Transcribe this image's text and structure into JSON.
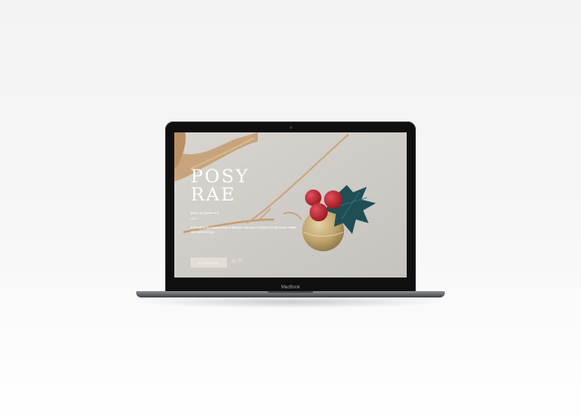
{
  "device": {
    "label": "MacBook"
  },
  "site": {
    "brand_line1": "POSY",
    "brand_line2": "RAE",
    "pronunciation": "posy rae [pəʊzɪ reɪ]",
    "tag": "noun",
    "description": "A thoughtfully curated floral & lifestyle collection of pieces for the home, made with care and joy.",
    "cta_label": "FLOWERS",
    "social": [
      "instagram",
      "pinterest"
    ]
  },
  "colors": {
    "screen_bg": "#cfccc7",
    "branch": "#c8a27a",
    "berry": "#c0202d",
    "leaf": "#1f4e55",
    "ornament": "#c9b07a"
  }
}
